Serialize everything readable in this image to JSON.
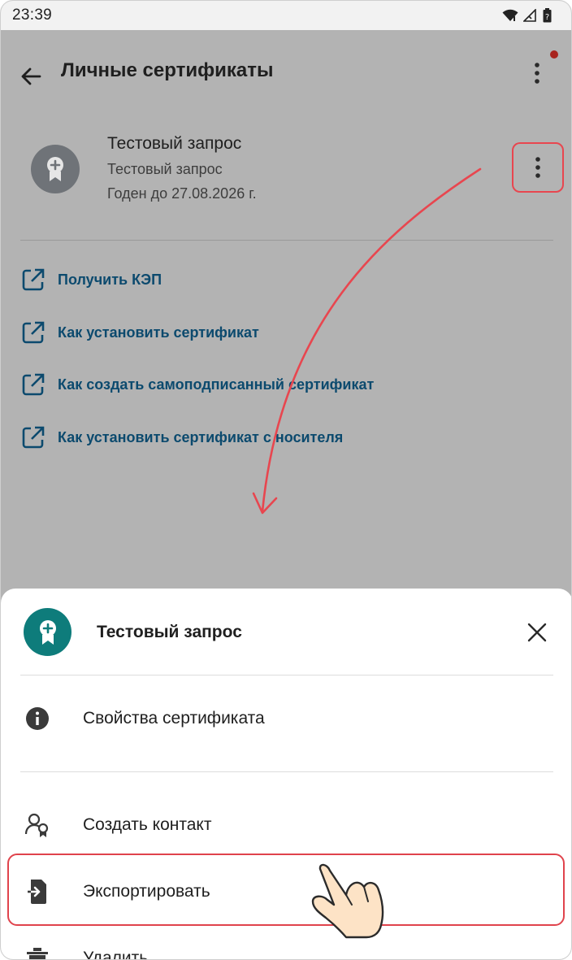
{
  "status_bar": {
    "time": "23:39"
  },
  "app_bar": {
    "title": "Личные сертификаты"
  },
  "certificate": {
    "title": "Тестовый запрос",
    "subtitle": "Тестовый запрос",
    "valid_until": "Годен до 27.08.2026 г."
  },
  "links": [
    {
      "label": "Получить КЭП"
    },
    {
      "label": "Как установить сертификат"
    },
    {
      "label": "Как создать самоподписанный сертификат"
    },
    {
      "label": "Как установить сертификат с носителя"
    }
  ],
  "sheet": {
    "title": "Тестовый запрос",
    "items": [
      {
        "label": "Свойства сертификата",
        "icon": "info-icon"
      },
      {
        "label": "Создать контакт",
        "icon": "add-contact-icon"
      },
      {
        "label": "Экспортировать",
        "icon": "export-icon"
      },
      {
        "label": "Удалить",
        "icon": "trash-icon"
      }
    ]
  },
  "colors": {
    "accent_teal": "#0e7c7b",
    "link_blue": "#0c4a6e",
    "highlight_red": "#e0434c",
    "notification_dot": "#a8241e"
  }
}
